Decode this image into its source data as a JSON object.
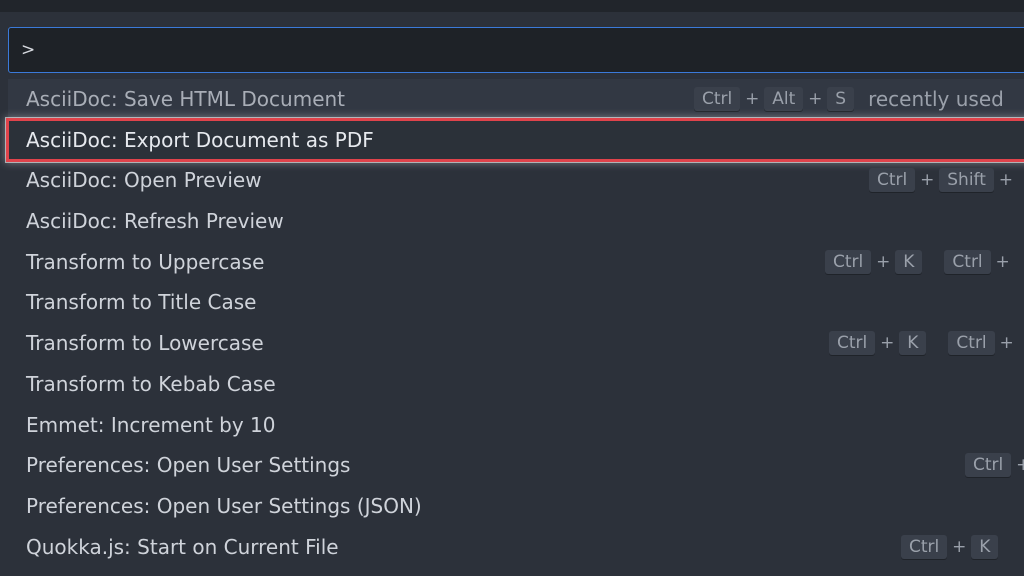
{
  "search": {
    "value": ">"
  },
  "items": [
    {
      "label": "AsciiDoc: Save HTML Document",
      "keys": [
        "Ctrl",
        "Alt",
        "S"
      ],
      "tag": "recently used"
    },
    {
      "label": "AsciiDoc: Export Document as PDF"
    },
    {
      "label": "AsciiDoc: Open Preview",
      "keys": [
        "Ctrl",
        "Shift"
      ]
    },
    {
      "label": "AsciiDoc: Refresh Preview"
    },
    {
      "label": "Transform to Uppercase",
      "chord1": [
        "Ctrl",
        "K"
      ],
      "chord2": [
        "Ctrl"
      ]
    },
    {
      "label": "Transform to Title Case"
    },
    {
      "label": "Transform to Lowercase",
      "chord1": [
        "Ctrl",
        "K"
      ],
      "chord2": [
        "Ctrl"
      ]
    },
    {
      "label": "Transform to Kebab Case"
    },
    {
      "label": "Emmet: Increment by 10"
    },
    {
      "label": "Preferences: Open User Settings",
      "keys": [
        "Ctrl"
      ]
    },
    {
      "label": "Preferences: Open User Settings (JSON)"
    },
    {
      "label": "Quokka.js: Start on Current File",
      "keys": [
        "Ctrl",
        "K"
      ]
    }
  ],
  "colors": {
    "accent": "#3b7ad9",
    "highlight": "#e0434b"
  }
}
